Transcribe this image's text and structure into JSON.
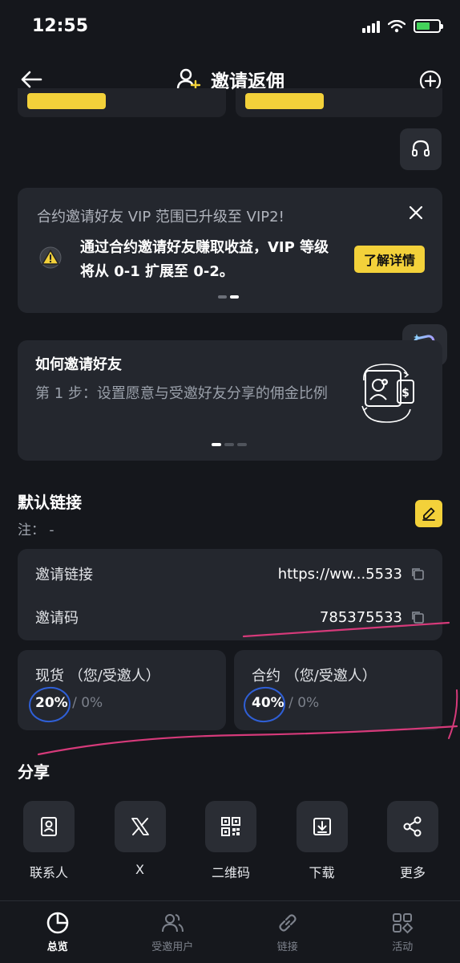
{
  "status_bar": {
    "time": "12:55"
  },
  "header": {
    "title": "邀请返佣"
  },
  "notice": {
    "title": "合约邀请好友 VIP 范围已升级至 VIP2!",
    "body": "通过合约邀请好友赚取收益，VIP 等级将从 0-1 扩展至 0-2。",
    "button": "了解详情"
  },
  "howto": {
    "title": "如何邀请好友",
    "step": "第 1 步：设置愿意与受邀好友分享的佣金比例"
  },
  "default_link": {
    "title": "默认链接",
    "note": "注： -",
    "invite_link_label": "邀请链接",
    "invite_link_value": "https://ww...5533",
    "invite_code_label": "邀请码",
    "invite_code_value": "785375533"
  },
  "rates": [
    {
      "label": "现货 （您/受邀人）",
      "main": "20%",
      "sub": " / 0%"
    },
    {
      "label": "合约 （您/受邀人）",
      "main": "40%",
      "sub": " / 0%"
    }
  ],
  "share": {
    "title": "分享",
    "items": [
      {
        "label": "联系人",
        "icon": "contacts-icon"
      },
      {
        "label": "X",
        "icon": "x-logo-icon"
      },
      {
        "label": "二维码",
        "icon": "qr-code-icon"
      },
      {
        "label": "下载",
        "icon": "download-icon"
      },
      {
        "label": "更多",
        "icon": "share-icon"
      }
    ]
  },
  "bottom_nav": [
    {
      "label": "总览",
      "icon": "pie-chart-icon",
      "active": true
    },
    {
      "label": "受邀用户",
      "icon": "users-icon",
      "active": false
    },
    {
      "label": "链接",
      "icon": "link-icon",
      "active": false
    },
    {
      "label": "活动",
      "icon": "activity-grid-icon",
      "active": false
    }
  ],
  "colors": {
    "accent": "#f3d13a",
    "background": "#15171c",
    "card": "#24272e",
    "annotation_pink": "#d63a7a",
    "annotation_blue": "#2f5fd6"
  }
}
